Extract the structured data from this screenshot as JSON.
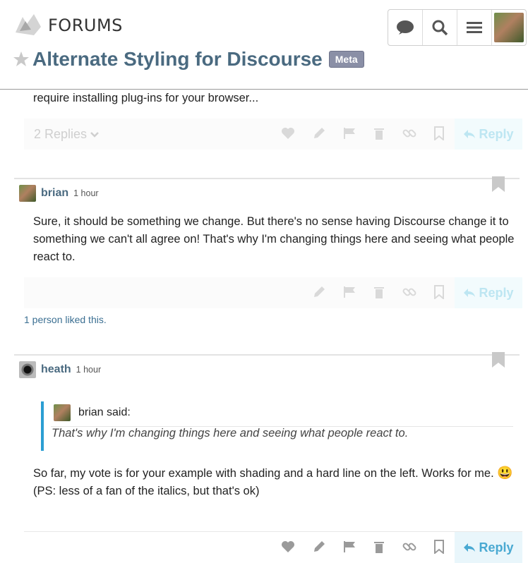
{
  "header": {
    "logo_text": "FORUMS",
    "title": "Alternate Styling for Discourse",
    "category": "Meta",
    "icons": [
      "chat-icon",
      "search-icon",
      "menu-icon",
      "user-avatar"
    ]
  },
  "post1": {
    "text_tail": "require installing plug-ins for your browser...",
    "replies_label": "2 Replies",
    "reply_label": "Reply"
  },
  "post2": {
    "username": "brian",
    "time": "1 hour",
    "body": "Sure, it should be something we change. But there's no sense having Discourse change it to something we can't all agree on! That's why I'm changing things here and seeing what people react to.",
    "likes_text": "1 person liked this.",
    "reply_label": "Reply"
  },
  "post3": {
    "username": "heath",
    "time": "1 hour",
    "quote_author": "brian said:",
    "quote_text": "That's why I'm changing things here and seeing what people react to.",
    "body_line1": "So far, my vote is for your example with shading and a hard line on the left. Works for me.",
    "emoji": "😃",
    "body_line2": "(PS: less of a fan of the italics, but that's ok)",
    "reply_label": "Reply"
  },
  "colors": {
    "accent": "#2b9ed3",
    "title": "#4a6a80",
    "badge": "#8a8fa6"
  }
}
